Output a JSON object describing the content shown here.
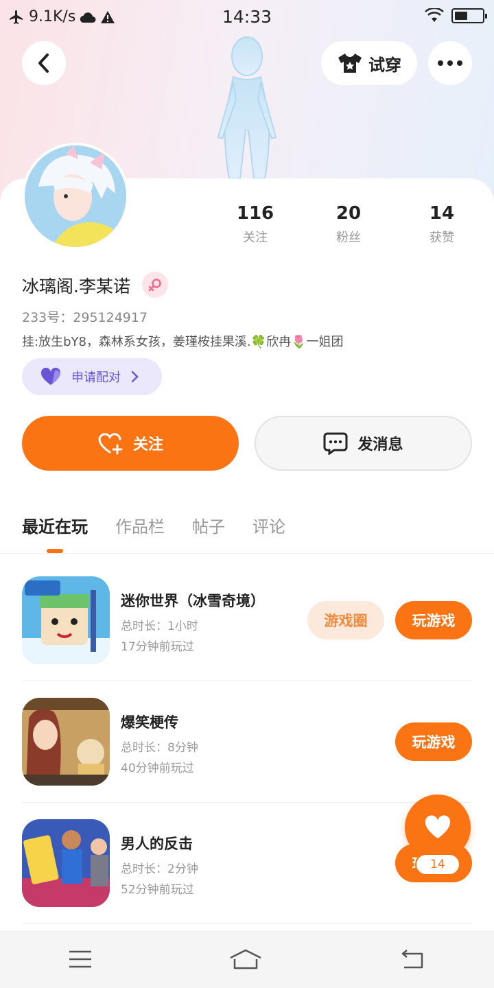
{
  "status_bar": {
    "net_speed": "9.1K/s",
    "time": "14:33"
  },
  "header": {
    "tryon_label": "试穿"
  },
  "profile": {
    "nickname": "冰璃阁.李某诺",
    "uid": "233号：295124917",
    "bio": "挂:放生bY8，森林系女孩，姜瑾桉挂果溪.🍀欣冉🌷一姐团",
    "pair_label": "申请配对"
  },
  "stats": [
    {
      "num": "116",
      "label": "关注"
    },
    {
      "num": "20",
      "label": "粉丝"
    },
    {
      "num": "14",
      "label": "获赞"
    }
  ],
  "actions": {
    "follow_label": "关注",
    "message_label": "发消息"
  },
  "tabs": [
    "最近在玩",
    "作品栏",
    "帖子",
    "评论"
  ],
  "games": [
    {
      "name": "迷你世界（冰雪奇境）",
      "duration": "总时长：1小时",
      "ago": "17分钟前玩过",
      "circle": "游戏圈",
      "play": "玩游戏"
    },
    {
      "name": "爆笑梗传",
      "duration": "总时长：8分钟",
      "ago": "40分钟前玩过",
      "play": "玩游戏"
    },
    {
      "name": "男人的反击",
      "duration": "总时长：2分钟",
      "ago": "52分钟前玩过",
      "play": "玩游戏"
    }
  ],
  "fab": {
    "count": "14"
  },
  "icons": [
    "airplane-icon",
    "cloud-icon",
    "warning-icon",
    "wifi-icon",
    "battery-icon",
    "back-icon",
    "tshirt-icon",
    "more-icon",
    "female-icon",
    "heart-icon",
    "chevron-right-icon",
    "heart-plus-icon",
    "chat-icon",
    "menu-icon",
    "home-icon",
    "return-icon"
  ],
  "colors": {
    "accent": "#fa7414",
    "pair": "#6a55d6"
  }
}
